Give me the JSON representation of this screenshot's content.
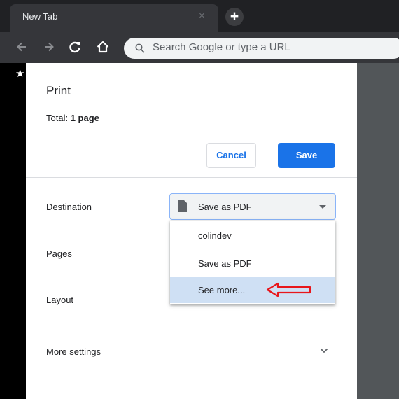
{
  "browser": {
    "tab_title": "New Tab",
    "tab_close": "×",
    "new_tab": "+",
    "omnibox_placeholder": "Search Google or type a URL"
  },
  "dialog": {
    "title": "Print",
    "total_label": "Total: ",
    "total_value": "1 page",
    "cancel_label": "Cancel",
    "save_label": "Save",
    "destination_label": "Destination",
    "destination_value": "Save as PDF",
    "pages_label": "Pages",
    "layout_label": "Layout",
    "more_settings_label": "More settings",
    "destination_options": [
      "colindev",
      "Save as PDF",
      "See more..."
    ]
  },
  "colors": {
    "accent": "#1a73e8",
    "highlight": "#cfe0f4",
    "annotation": "#e8161b"
  }
}
